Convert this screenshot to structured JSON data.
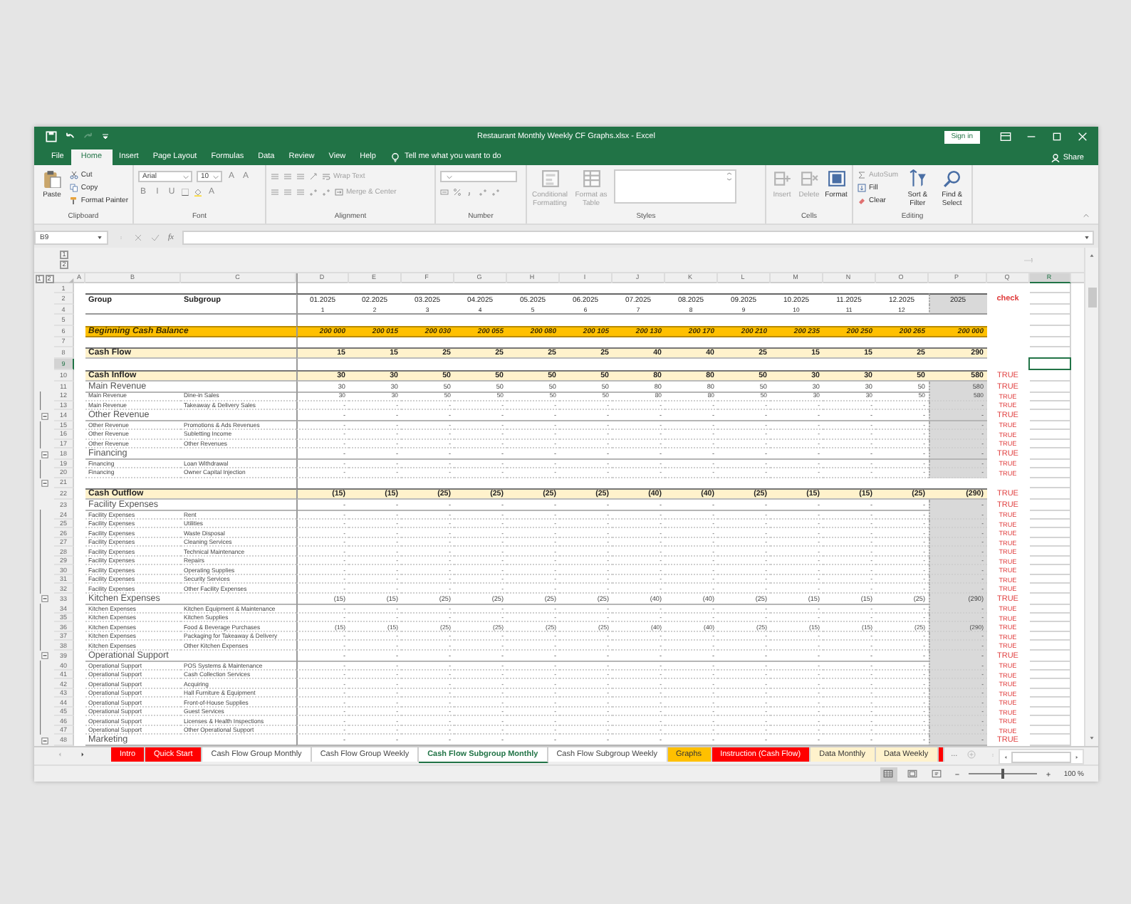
{
  "window": {
    "title": "Restaurant Monthly Weekly CF Graphs.xlsx  -  Excel",
    "sign_in": "Sign in"
  },
  "menu_tabs": [
    {
      "label": "File",
      "selected": false
    },
    {
      "label": "Home",
      "selected": true
    },
    {
      "label": "Insert",
      "selected": false
    },
    {
      "label": "Page Layout",
      "selected": false
    },
    {
      "label": "Formulas",
      "selected": false
    },
    {
      "label": "Data",
      "selected": false
    },
    {
      "label": "Review",
      "selected": false
    },
    {
      "label": "View",
      "selected": false
    },
    {
      "label": "Help",
      "selected": false
    }
  ],
  "tell_me": "Tell me what you want to do",
  "share": "Share",
  "ribbon": {
    "groups": [
      {
        "label": "Clipboard",
        "kind": "stack",
        "controls": [
          {
            "kind": "big",
            "label": "Paste",
            "disabled": false
          },
          {
            "kind": "small",
            "label": "Cut",
            "disabled": false
          },
          {
            "kind": "small",
            "label": "Copy",
            "disabled": false
          },
          {
            "kind": "small",
            "label": "Format Painter",
            "disabled": false
          }
        ]
      },
      {
        "label": "Font",
        "kind": "rows",
        "rows": [
          [
            {
              "kind": "combo",
              "value": "Arial"
            },
            {
              "kind": "combo",
              "value": "10"
            },
            {
              "kind": "glyph",
              "label": "A"
            },
            {
              "kind": "glyph",
              "label": "A"
            }
          ],
          [
            {
              "kind": "glyph",
              "label": "B"
            },
            {
              "kind": "glyph",
              "label": "I"
            },
            {
              "kind": "glyph",
              "label": "U"
            },
            {
              "kind": "icon"
            },
            {
              "kind": "icon"
            },
            {
              "kind": "glyph",
              "label": "A"
            }
          ]
        ]
      },
      {
        "label": "Alignment",
        "kind": "rows",
        "rows": [
          [
            {
              "kind": "icon"
            },
            {
              "kind": "icon"
            },
            {
              "kind": "icon"
            },
            {
              "kind": "icon"
            },
            {
              "kind": "small",
              "label": "Wrap Text",
              "disabled": true
            }
          ],
          [
            {
              "kind": "icon"
            },
            {
              "kind": "icon"
            },
            {
              "kind": "icon"
            },
            {
              "kind": "icon"
            },
            {
              "kind": "icon"
            },
            {
              "kind": "small",
              "label": "Merge & Center",
              "disabled": true
            }
          ]
        ]
      },
      {
        "label": "Number",
        "kind": "rows",
        "rows": [
          [
            {
              "kind": "combo"
            }
          ],
          [
            {
              "kind": "icon"
            },
            {
              "kind": "icon"
            },
            {
              "kind": "icon"
            },
            {
              "kind": "icon"
            },
            {
              "kind": "icon"
            }
          ]
        ]
      },
      {
        "label": "Styles",
        "kind": "stack",
        "controls": [
          {
            "kind": "big",
            "label": "Conditional Formatting",
            "disabled": true
          },
          {
            "kind": "big",
            "label": "Format as Table",
            "disabled": true
          },
          {
            "kind": "gallery"
          }
        ]
      },
      {
        "label": "Cells",
        "kind": "stack",
        "controls": [
          {
            "kind": "big",
            "label": "Insert",
            "disabled": true
          },
          {
            "kind": "big",
            "label": "Delete",
            "disabled": true
          },
          {
            "kind": "big",
            "label": "Format",
            "disabled": false
          }
        ]
      },
      {
        "label": "Editing",
        "kind": "stack",
        "controls": [
          {
            "kind": "small",
            "label": "AutoSum",
            "disabled": true
          },
          {
            "kind": "small",
            "label": "Fill",
            "disabled": false
          },
          {
            "kind": "small",
            "label": "Clear",
            "disabled": false
          },
          {
            "kind": "big",
            "label": "Sort & Filter",
            "disabled": false
          },
          {
            "kind": "big",
            "label": "Find & Select",
            "disabled": false
          }
        ]
      }
    ]
  },
  "formula_bar": {
    "name_box": "B9",
    "function_label": "fx"
  },
  "column_levels": [
    "1",
    "2"
  ],
  "row_levels": [
    "1",
    "2"
  ],
  "columns": [
    {
      "label": "A",
      "selected": false
    },
    {
      "label": "B",
      "selected": false
    },
    {
      "label": "C",
      "selected": false
    },
    {
      "label": "D",
      "selected": false
    },
    {
      "label": "E",
      "selected": false
    },
    {
      "label": "F",
      "selected": false
    },
    {
      "label": "G",
      "selected": false
    },
    {
      "label": "H",
      "selected": false
    },
    {
      "label": "I",
      "selected": false
    },
    {
      "label": "J",
      "selected": false
    },
    {
      "label": "K",
      "selected": false
    },
    {
      "label": "L",
      "selected": false
    },
    {
      "label": "M",
      "selected": false
    },
    {
      "label": "N",
      "selected": false
    },
    {
      "label": "O",
      "selected": false
    },
    {
      "label": "P",
      "selected": false
    },
    {
      "label": "Q",
      "selected": false
    },
    {
      "label": "R",
      "selected": true
    }
  ],
  "rows": [
    {
      "num": "1",
      "kind": "blank",
      "selected": false,
      "outline_button": false
    },
    {
      "num": "2",
      "kind": "dates",
      "selected": false,
      "outline_button": false,
      "b": "Group",
      "c": "Subgroup",
      "values": [
        "01.2025",
        "02.2025",
        "03.2025",
        "04.2025",
        "05.2025",
        "06.2025",
        "07.2025",
        "08.2025",
        "09.2025",
        "10.2025",
        "11.2025",
        "12.2025",
        "2025"
      ],
      "check": "check"
    },
    {
      "num": "4",
      "kind": "periods",
      "selected": false,
      "outline_button": false,
      "values": [
        "1",
        "2",
        "3",
        "4",
        "5",
        "6",
        "7",
        "8",
        "9",
        "10",
        "11",
        "12"
      ]
    },
    {
      "num": "5",
      "kind": "blank",
      "selected": false,
      "outline_button": false
    },
    {
      "num": "6",
      "kind": "balance",
      "selected": false,
      "outline_button": false,
      "b": "Beginning Cash Balance",
      "values": [
        "200 000",
        "200 015",
        "200 030",
        "200 055",
        "200 080",
        "200 105",
        "200 130",
        "200 170",
        "200 210",
        "200 235",
        "200 250",
        "200 265",
        "200 000"
      ]
    },
    {
      "num": "7",
      "kind": "blank",
      "selected": false,
      "outline_button": false
    },
    {
      "num": "8",
      "kind": "total",
      "selected": false,
      "outline_button": false,
      "b": "Cash Flow",
      "values": [
        "15",
        "15",
        "25",
        "25",
        "25",
        "25",
        "40",
        "40",
        "25",
        "15",
        "15",
        "25",
        "290"
      ]
    },
    {
      "num": "9",
      "kind": "blank",
      "selected": true,
      "outline_button": false
    },
    {
      "num": "10",
      "kind": "total",
      "selected": false,
      "outline_button": false,
      "b": "Cash Inflow",
      "values": [
        "30",
        "30",
        "50",
        "50",
        "50",
        "50",
        "80",
        "80",
        "50",
        "30",
        "30",
        "50",
        "580"
      ],
      "check": "TRUE"
    },
    {
      "num": "11",
      "kind": "group",
      "selected": false,
      "outline_button": false,
      "b": "Main Revenue",
      "values": [
        "30",
        "30",
        "50",
        "50",
        "50",
        "50",
        "80",
        "80",
        "50",
        "30",
        "30",
        "50",
        "580"
      ],
      "check": "TRUE"
    },
    {
      "num": "12",
      "kind": "item",
      "selected": false,
      "outline_button": false,
      "b": "Main Revenue",
      "c": "Dine-in Sales",
      "values": [
        "30",
        "30",
        "50",
        "50",
        "50",
        "50",
        "80",
        "80",
        "50",
        "30",
        "30",
        "50",
        "580"
      ],
      "check": "TRUE"
    },
    {
      "num": "13",
      "kind": "item",
      "selected": false,
      "outline_button": false,
      "b": "Main Revenue",
      "c": "Takeaway & Delivery Sales",
      "values": [
        "-",
        "-",
        "-",
        "-",
        "-",
        "-",
        "-",
        "-",
        "-",
        "-",
        "-",
        "-",
        "-"
      ],
      "check": "TRUE"
    },
    {
      "num": "14",
      "kind": "group",
      "selected": false,
      "outline_button": true,
      "b": "Other Revenue",
      "values": [
        "-",
        "-",
        "-",
        "-",
        "-",
        "-",
        "-",
        "-",
        "-",
        "-",
        "-",
        "-",
        "-"
      ],
      "check": "TRUE"
    },
    {
      "num": "15",
      "kind": "item",
      "selected": false,
      "outline_button": false,
      "b": "Other Revenue",
      "c": "Promotions & Ads Revenues",
      "values": [
        "-",
        "-",
        "-",
        "-",
        "-",
        "-",
        "-",
        "-",
        "-",
        "-",
        "-",
        "-",
        "-"
      ],
      "check": "TRUE"
    },
    {
      "num": "16",
      "kind": "item",
      "selected": false,
      "outline_button": false,
      "b": "Other Revenue",
      "c": "Subletting Income",
      "values": [
        "-",
        "-",
        "-",
        "-",
        "-",
        "-",
        "-",
        "-",
        "-",
        "-",
        "-",
        "-",
        "-"
      ],
      "check": "TRUE"
    },
    {
      "num": "17",
      "kind": "item",
      "selected": false,
      "outline_button": false,
      "b": "Other Revenue",
      "c": "Other Revenues",
      "values": [
        "-",
        "-",
        "-",
        "-",
        "-",
        "-",
        "-",
        "-",
        "-",
        "-",
        "-",
        "-",
        "-"
      ],
      "check": "TRUE"
    },
    {
      "num": "18",
      "kind": "group",
      "selected": false,
      "outline_button": true,
      "b": "Financing",
      "values": [
        "-",
        "-",
        "-",
        "-",
        "-",
        "-",
        "-",
        "-",
        "-",
        "-",
        "-",
        "-",
        "-"
      ],
      "check": "TRUE"
    },
    {
      "num": "19",
      "kind": "item",
      "selected": false,
      "outline_button": false,
      "b": "Financing",
      "c": "Loan Withdrawal",
      "values": [
        "-",
        "-",
        "-",
        "-",
        "-",
        "-",
        "-",
        "-",
        "-",
        "-",
        "-",
        "-",
        "-"
      ],
      "check": "TRUE"
    },
    {
      "num": "20",
      "kind": "item",
      "selected": false,
      "outline_button": false,
      "b": "Financing",
      "c": "Owner Capital Injection",
      "values": [
        "-",
        "-",
        "-",
        "-",
        "-",
        "-",
        "-",
        "-",
        "-",
        "-",
        "-",
        "-",
        "-"
      ],
      "check": "TRUE"
    },
    {
      "num": "21",
      "kind": "blank",
      "selected": false,
      "outline_button": true
    },
    {
      "num": "22",
      "kind": "total",
      "selected": false,
      "outline_button": false,
      "b": "Cash Outflow",
      "values": [
        "(15)",
        "(15)",
        "(25)",
        "(25)",
        "(25)",
        "(25)",
        "(40)",
        "(40)",
        "(25)",
        "(15)",
        "(15)",
        "(25)",
        "(290)"
      ],
      "check": "TRUE"
    },
    {
      "num": "23",
      "kind": "group",
      "selected": false,
      "outline_button": false,
      "b": "Facility Expenses",
      "values": [
        "-",
        "-",
        "-",
        "-",
        "-",
        "-",
        "-",
        "-",
        "-",
        "-",
        "-",
        "-",
        "-"
      ],
      "check": "TRUE"
    },
    {
      "num": "24",
      "kind": "item",
      "selected": false,
      "outline_button": false,
      "b": "Facility Expenses",
      "c": "Rent",
      "values": [
        "-",
        "-",
        "-",
        "-",
        "-",
        "-",
        "-",
        "-",
        "-",
        "-",
        "-",
        "-",
        "-"
      ],
      "check": "TRUE"
    },
    {
      "num": "25",
      "kind": "item",
      "selected": false,
      "outline_button": false,
      "b": "Facility Expenses",
      "c": "Utilities",
      "values": [
        "-",
        "-",
        "-",
        "-",
        "-",
        "-",
        "-",
        "-",
        "-",
        "-",
        "-",
        "-",
        "-"
      ],
      "check": "TRUE"
    },
    {
      "num": "26",
      "kind": "item",
      "selected": false,
      "outline_button": false,
      "b": "Facility Expenses",
      "c": "Waste Disposal",
      "values": [
        "-",
        "-",
        "-",
        "-",
        "-",
        "-",
        "-",
        "-",
        "-",
        "-",
        "-",
        "-",
        "-"
      ],
      "check": "TRUE"
    },
    {
      "num": "27",
      "kind": "item",
      "selected": false,
      "outline_button": false,
      "b": "Facility Expenses",
      "c": "Cleaning Services",
      "values": [
        "-",
        "-",
        "-",
        "-",
        "-",
        "-",
        "-",
        "-",
        "-",
        "-",
        "-",
        "-",
        "-"
      ],
      "check": "TRUE"
    },
    {
      "num": "28",
      "kind": "item",
      "selected": false,
      "outline_button": false,
      "b": "Facility Expenses",
      "c": "Technical Maintenance",
      "values": [
        "-",
        "-",
        "-",
        "-",
        "-",
        "-",
        "-",
        "-",
        "-",
        "-",
        "-",
        "-",
        "-"
      ],
      "check": "TRUE"
    },
    {
      "num": "29",
      "kind": "item",
      "selected": false,
      "outline_button": false,
      "b": "Facility Expenses",
      "c": "Repairs",
      "values": [
        "-",
        "-",
        "-",
        "-",
        "-",
        "-",
        "-",
        "-",
        "-",
        "-",
        "-",
        "-",
        "-"
      ],
      "check": "TRUE"
    },
    {
      "num": "30",
      "kind": "item",
      "selected": false,
      "outline_button": false,
      "b": "Facility Expenses",
      "c": "Operating Supplies",
      "values": [
        "-",
        "-",
        "-",
        "-",
        "-",
        "-",
        "-",
        "-",
        "-",
        "-",
        "-",
        "-",
        "-"
      ],
      "check": "TRUE"
    },
    {
      "num": "31",
      "kind": "item",
      "selected": false,
      "outline_button": false,
      "b": "Facility Expenses",
      "c": "Security Services",
      "values": [
        "-",
        "-",
        "-",
        "-",
        "-",
        "-",
        "-",
        "-",
        "-",
        "-",
        "-",
        "-",
        "-"
      ],
      "check": "TRUE"
    },
    {
      "num": "32",
      "kind": "item",
      "selected": false,
      "outline_button": false,
      "b": "Facility Expenses",
      "c": "Other Facility Expenses",
      "values": [
        "-",
        "-",
        "-",
        "-",
        "-",
        "-",
        "-",
        "-",
        "-",
        "-",
        "-",
        "-",
        "-"
      ],
      "check": "TRUE"
    },
    {
      "num": "33",
      "kind": "group",
      "selected": false,
      "outline_button": true,
      "b": "Kitchen Expenses",
      "values": [
        "(15)",
        "(15)",
        "(25)",
        "(25)",
        "(25)",
        "(25)",
        "(40)",
        "(40)",
        "(25)",
        "(15)",
        "(15)",
        "(25)",
        "(290)"
      ],
      "check": "TRUE"
    },
    {
      "num": "34",
      "kind": "item",
      "selected": false,
      "outline_button": false,
      "b": "Kitchen Expenses",
      "c": "Kitchen Equipment & Maintenance",
      "values": [
        "-",
        "-",
        "-",
        "-",
        "-",
        "-",
        "-",
        "-",
        "-",
        "-",
        "-",
        "-",
        "-"
      ],
      "check": "TRUE"
    },
    {
      "num": "35",
      "kind": "item",
      "selected": false,
      "outline_button": false,
      "b": "Kitchen Expenses",
      "c": "Kitchen Supplies",
      "values": [
        "-",
        "-",
        "-",
        "-",
        "-",
        "-",
        "-",
        "-",
        "-",
        "-",
        "-",
        "-",
        "-"
      ],
      "check": "TRUE"
    },
    {
      "num": "36",
      "kind": "item",
      "selected": false,
      "outline_button": false,
      "b": "Kitchen Expenses",
      "c": "Food & Beverage Purchases",
      "values": [
        "(15)",
        "(15)",
        "(25)",
        "(25)",
        "(25)",
        "(25)",
        "(40)",
        "(40)",
        "(25)",
        "(15)",
        "(15)",
        "(25)",
        "(290)"
      ],
      "check": "TRUE"
    },
    {
      "num": "37",
      "kind": "item",
      "selected": false,
      "outline_button": false,
      "b": "Kitchen Expenses",
      "c": "Packaging for Takeaway & Delivery",
      "values": [
        "-",
        "-",
        "-",
        "-",
        "-",
        "-",
        "-",
        "-",
        "-",
        "-",
        "-",
        "-",
        "-"
      ],
      "check": "TRUE"
    },
    {
      "num": "38",
      "kind": "item",
      "selected": false,
      "outline_button": false,
      "b": "Kitchen Expenses",
      "c": "Other Kitchen Expenses",
      "values": [
        "-",
        "-",
        "-",
        "-",
        "-",
        "-",
        "-",
        "-",
        "-",
        "-",
        "-",
        "-",
        "-"
      ],
      "check": "TRUE"
    },
    {
      "num": "39",
      "kind": "group",
      "selected": false,
      "outline_button": true,
      "b": "Operational Support",
      "values": [
        "-",
        "-",
        "-",
        "-",
        "-",
        "-",
        "-",
        "-",
        "-",
        "-",
        "-",
        "-",
        "-"
      ],
      "check": "TRUE"
    },
    {
      "num": "40",
      "kind": "item",
      "selected": false,
      "outline_button": false,
      "b": "Operational Support",
      "c": "POS Systems & Maintenance",
      "values": [
        "-",
        "-",
        "-",
        "-",
        "-",
        "-",
        "-",
        "-",
        "-",
        "-",
        "-",
        "-",
        "-"
      ],
      "check": "TRUE"
    },
    {
      "num": "41",
      "kind": "item",
      "selected": false,
      "outline_button": false,
      "b": "Operational Support",
      "c": "Cash Collection Services",
      "values": [
        "-",
        "-",
        "-",
        "-",
        "-",
        "-",
        "-",
        "-",
        "-",
        "-",
        "-",
        "-",
        "-"
      ],
      "check": "TRUE"
    },
    {
      "num": "42",
      "kind": "item",
      "selected": false,
      "outline_button": false,
      "b": "Operational Support",
      "c": "Acquiring",
      "values": [
        "-",
        "-",
        "-",
        "-",
        "-",
        "-",
        "-",
        "-",
        "-",
        "-",
        "-",
        "-",
        "-"
      ],
      "check": "TRUE"
    },
    {
      "num": "43",
      "kind": "item",
      "selected": false,
      "outline_button": false,
      "b": "Operational Support",
      "c": "Hall Furniture & Equipment",
      "values": [
        "-",
        "-",
        "-",
        "-",
        "-",
        "-",
        "-",
        "-",
        "-",
        "-",
        "-",
        "-",
        "-"
      ],
      "check": "TRUE"
    },
    {
      "num": "44",
      "kind": "item",
      "selected": false,
      "outline_button": false,
      "b": "Operational Support",
      "c": "Front-of-House Supplies",
      "values": [
        "-",
        "-",
        "-",
        "-",
        "-",
        "-",
        "-",
        "-",
        "-",
        "-",
        "-",
        "-",
        "-"
      ],
      "check": "TRUE"
    },
    {
      "num": "45",
      "kind": "item",
      "selected": false,
      "outline_button": false,
      "b": "Operational Support",
      "c": "Guest Services",
      "values": [
        "-",
        "-",
        "-",
        "-",
        "-",
        "-",
        "-",
        "-",
        "-",
        "-",
        "-",
        "-",
        "-"
      ],
      "check": "TRUE"
    },
    {
      "num": "46",
      "kind": "item",
      "selected": false,
      "outline_button": false,
      "b": "Operational Support",
      "c": "Licenses & Health Inspections",
      "values": [
        "-",
        "-",
        "-",
        "-",
        "-",
        "-",
        "-",
        "-",
        "-",
        "-",
        "-",
        "-",
        "-"
      ],
      "check": "TRUE"
    },
    {
      "num": "47",
      "kind": "item",
      "selected": false,
      "outline_button": false,
      "b": "Operational Support",
      "c": "Other Operational Support",
      "values": [
        "-",
        "-",
        "-",
        "-",
        "-",
        "-",
        "-",
        "-",
        "-",
        "-",
        "-",
        "-",
        "-"
      ],
      "check": "TRUE"
    },
    {
      "num": "48",
      "kind": "group",
      "selected": false,
      "outline_button": true,
      "b": "Marketing",
      "values": [
        "-",
        "-",
        "-",
        "-",
        "-",
        "-",
        "-",
        "-",
        "-",
        "-",
        "-",
        "-",
        "-"
      ],
      "check": "TRUE"
    }
  ],
  "sheet_tabs": [
    {
      "label": "Intro",
      "color": "#ff0000",
      "selected": false
    },
    {
      "label": "Quick Start",
      "color": "#ff0000",
      "selected": false
    },
    {
      "label": "Cash Flow Group Monthly",
      "selected": false
    },
    {
      "label": "Cash Flow Group Weekly",
      "selected": false
    },
    {
      "label": "Cash Flow Subgroup Monthly",
      "selected": true
    },
    {
      "label": "Cash Flow Subgroup Weekly",
      "selected": false
    },
    {
      "label": "Graphs",
      "color": "#ffc000",
      "selected": false
    },
    {
      "label": "Instruction (Cash Flow)",
      "color": "#ff0000",
      "selected": false
    },
    {
      "label": "Data Monthly",
      "color": "#fff2cc",
      "selected": false
    },
    {
      "label": "Data Weekly",
      "color": "#fff2cc",
      "selected": false
    },
    {
      "color": "#ff0000",
      "selected": false
    }
  ],
  "more_tabs": "...",
  "status_bar": {
    "views": [
      {
        "selected": true
      },
      {
        "selected": false
      },
      {
        "selected": false
      }
    ],
    "zoom_slider": {
      "level": 0.5
    },
    "zoom": "100 %"
  }
}
